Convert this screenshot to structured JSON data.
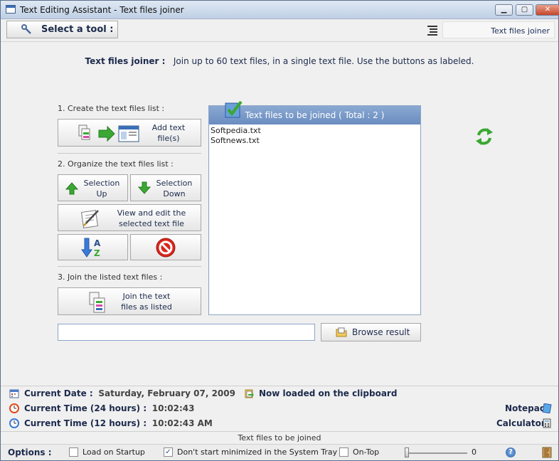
{
  "window": {
    "title": "Text Editing Assistant - Text files joiner",
    "minimize": "▁",
    "maximize": "▢",
    "close": "✕"
  },
  "toolbar": {
    "select_tool_label": "Select a tool :",
    "current_tool": "Text files joiner"
  },
  "headline": {
    "label": "Text files joiner :",
    "description": "Join up to 60 text files, in a single text file. Use the buttons as labeled."
  },
  "steps": {
    "create": "1. Create the text files list :",
    "organize": "2. Organize the text files list :",
    "join": "3. Join the listed text files :"
  },
  "buttons": {
    "add_line1": "Add text",
    "add_line2": "file(s)",
    "up_line1": "Selection",
    "up_line2": "Up",
    "down_line1": "Selection",
    "down_line2": "Down",
    "view_line1": "View and edit the",
    "view_line2": "selected text file",
    "join_line1": "Join the  text",
    "join_line2": "files as listed",
    "browse": "Browse result"
  },
  "listbox": {
    "header": "Text files to be joined ( Total : 2 )",
    "items": [
      "Softpedia.txt",
      "Softnews.txt"
    ]
  },
  "result_path": {
    "value": ""
  },
  "info": {
    "date_label": "Current Date :",
    "date_value": "Saturday, February 07, 2009",
    "time24_label": "Current Time (24 hours) :",
    "time24_value": "10:02:43",
    "time12_label": "Current Time (12 hours) :",
    "time12_value": "10:02:43 AM",
    "clipboard": "Now loaded on the clipboard",
    "notepad": "Notepad",
    "calculator": "Calculator"
  },
  "status": {
    "text": "Text files to be joined"
  },
  "options": {
    "label": "Options :",
    "load_startup": "Load on Startup",
    "load_startup_checked": false,
    "no_minimize": "Don't start minimized in the System Tray",
    "no_minimize_checked": true,
    "on_top": "On-Top",
    "on_top_checked": false,
    "opacity_value": "0",
    "help": "?"
  },
  "colors": {
    "accent": "#6a8cc0",
    "text_dark": "#1c2a4c",
    "green_icon": "#3aa832",
    "stop_red": "#d9261c"
  }
}
